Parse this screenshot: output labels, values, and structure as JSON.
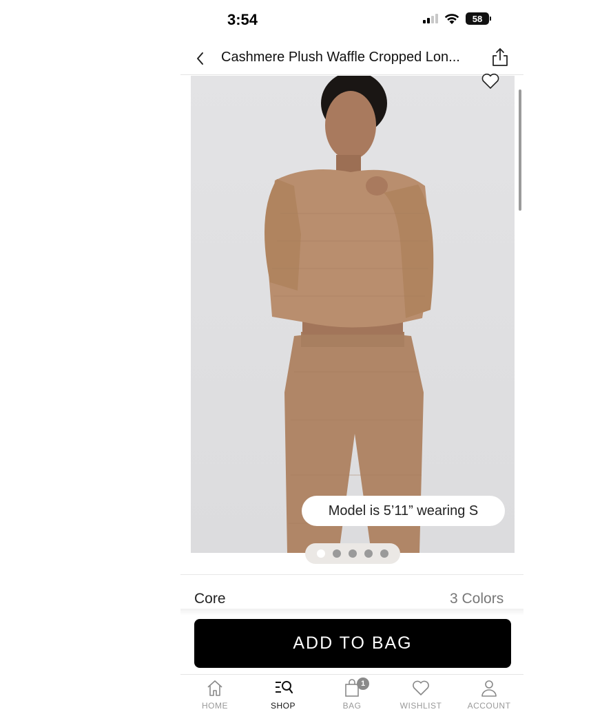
{
  "status_bar": {
    "time": "3:54",
    "battery": "58"
  },
  "header": {
    "title": "Cashmere Plush Waffle Cropped Lon..."
  },
  "product": {
    "model_note": "Model is 5’11” wearing S",
    "image_count": 5,
    "active_image": 1,
    "collection": "Core",
    "colors_count": "3 Colors"
  },
  "cta": {
    "add_to_bag": "ADD TO BAG"
  },
  "tabbar": {
    "items": [
      {
        "label": "HOME",
        "icon": "home-icon"
      },
      {
        "label": "SHOP",
        "icon": "shop-icon",
        "active": true
      },
      {
        "label": "BAG",
        "icon": "bag-icon",
        "badge": "1"
      },
      {
        "label": "WISHLIST",
        "icon": "heart-icon"
      },
      {
        "label": "ACCOUNT",
        "icon": "account-icon"
      }
    ]
  },
  "colors": {
    "garment": "#b98e6e",
    "button": "#000000",
    "image_bg": "#e0e0e2"
  }
}
